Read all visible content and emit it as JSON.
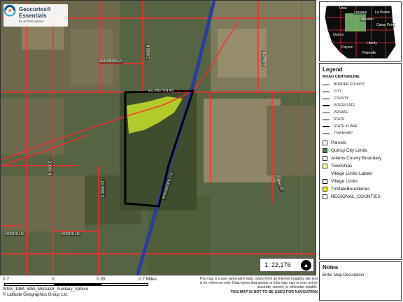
{
  "logo": {
    "line1": "Geocortex®",
    "line2": "Essentials",
    "line3": "for ArcGIS Server"
  },
  "map": {
    "scale_text": "1: 22,176",
    "north_glyph": "▲",
    "road_labels": {
      "audubon": "AUDUBON LN",
      "e_road_a": "N 2800 E",
      "e_road_b": "N 2790 E",
      "ellington": "ELLINGTON RD",
      "n2600e": "N 2600 E",
      "interstate": "INTERSTATE 172",
      "e2660": "E 2660 ST",
      "e2650": "E 2650 ST",
      "kochs1": "KOCHS LN",
      "kochs2": "KOCHS LN"
    },
    "colors": {
      "road": "#ff2a2a",
      "interstate": "#2b3e9e",
      "boundary": "#000000",
      "field_highlight": "#c8e02a"
    }
  },
  "overview": {
    "towns": [
      "Ursa",
      "Lorraine",
      "La Prairie",
      "Mendon",
      "Camp Point",
      "Quincy",
      "Payson",
      "Liberty",
      "Plainville"
    ]
  },
  "legend": {
    "title": "Legend",
    "road_section": "ROAD CENTERLINE",
    "road_types": [
      "BORDER COUNTY",
      "CITY",
      "COUNTY",
      "INTERSTATE",
      "PRIVATE",
      "STATE",
      "STATE 4 LANE",
      "TOWNSHIP"
    ],
    "layers": [
      {
        "label": "Parcels",
        "color": "#ffffff"
      },
      {
        "label": "Quincy City Limits",
        "color": "#3a8a3a"
      },
      {
        "label": "Adams County Boundary",
        "color": "#ffffff"
      },
      {
        "label": "Townships",
        "color": "#ffff99"
      },
      {
        "label": "Village Limits Labels",
        "color": ""
      },
      {
        "label": "Village Limits",
        "color": "#ffffff"
      },
      {
        "label": "TriStateBoundaries",
        "color": "#ffee00"
      },
      {
        "label": "REGIONAL_COUNTIES",
        "color": "#ffffff"
      }
    ]
  },
  "notes": {
    "title": "Notes",
    "text": "Enter Map Description"
  },
  "scalebar": {
    "labels": [
      "0.7",
      "0",
      "0.35",
      "0.7 Miles"
    ],
    "crs": "WGS_1984_Web_Mercator_Auxiliary_Sphere",
    "copyright": "© Latitude Geographics Group Ltd."
  },
  "disclaimer": {
    "line1": "This map is a user generated static output from an Internet mapping site and",
    "line2": "is for reference only. Data layers that appear on this map may or may not be",
    "line3": "accurate, current, or otherwise reliable.",
    "line4": "THIS MAP IS NOT TO BE USED FOR NAVIGATION"
  }
}
